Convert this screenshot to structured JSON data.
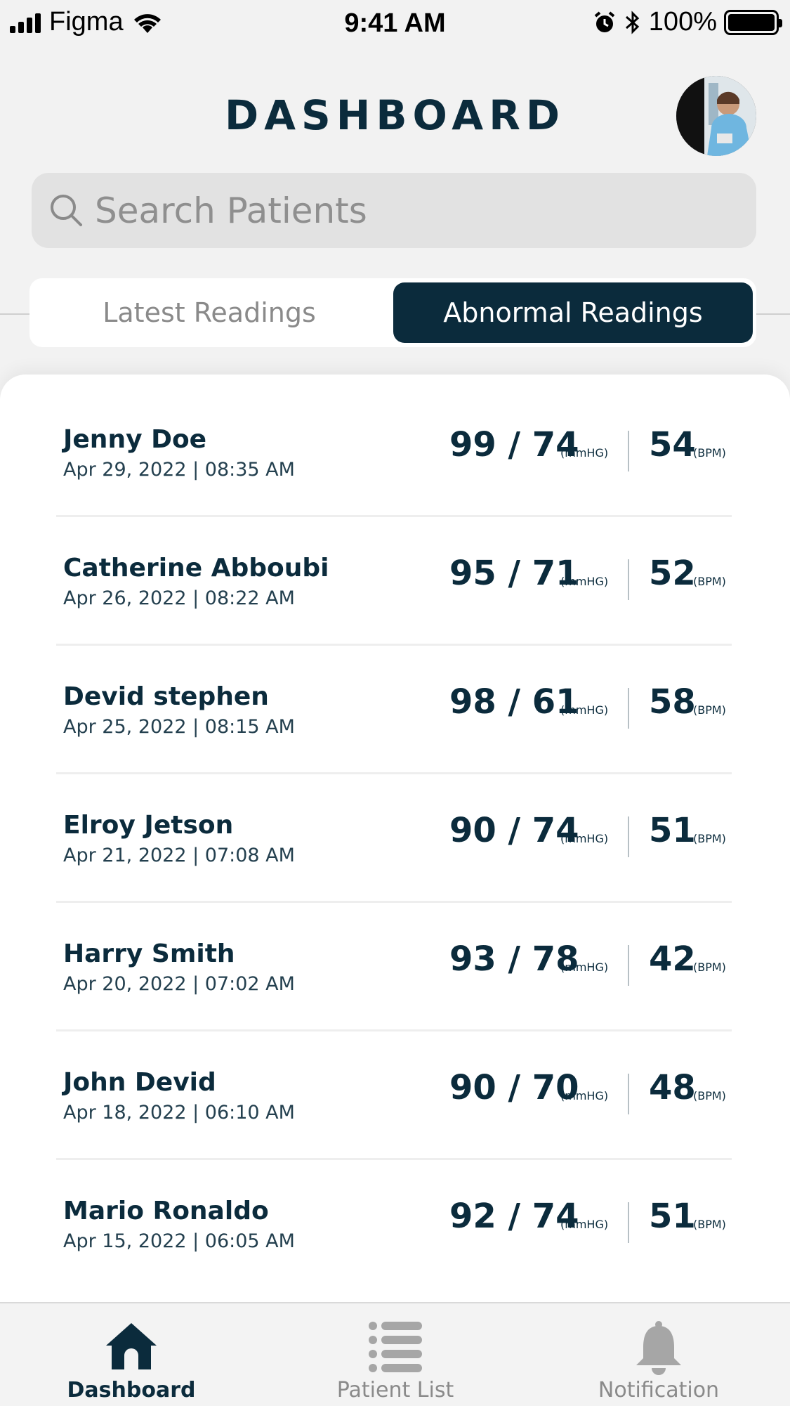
{
  "status_bar": {
    "carrier": "Figma",
    "time": "9:41 AM",
    "battery": "100%"
  },
  "header": {
    "title": "DASHBOARD"
  },
  "search": {
    "placeholder": "Search Patients"
  },
  "tabs": [
    {
      "label": "Latest Readings",
      "active": false
    },
    {
      "label": "Abnormal Readings",
      "active": true
    }
  ],
  "units": {
    "bp": "(mmHG)",
    "hr": "(BPM)"
  },
  "readings": [
    {
      "name": "Jenny Doe",
      "datetime": "Apr 29, 2022 | 08:35 AM",
      "bp": "99 / 74",
      "hr": "54"
    },
    {
      "name": "Catherine Abboubi",
      "datetime": "Apr 26, 2022 | 08:22 AM",
      "bp": "95 / 71",
      "hr": "52"
    },
    {
      "name": "Devid stephen",
      "datetime": "Apr 25, 2022 | 08:15 AM",
      "bp": "98 / 61",
      "hr": "58"
    },
    {
      "name": "Elroy Jetson",
      "datetime": "Apr 21, 2022 | 07:08 AM",
      "bp": "90 / 74",
      "hr": "51"
    },
    {
      "name": "Harry Smith",
      "datetime": "Apr 20, 2022 | 07:02 AM",
      "bp": "93 / 78",
      "hr": "42"
    },
    {
      "name": "John Devid",
      "datetime": "Apr 18, 2022 | 06:10 AM",
      "bp": "90 / 70",
      "hr": "48"
    },
    {
      "name": "Mario Ronaldo",
      "datetime": "Apr 15, 2022 | 06:05 AM",
      "bp": "92 / 74",
      "hr": "51"
    }
  ],
  "bottom_nav": [
    {
      "label": "Dashboard",
      "icon": "home-icon",
      "active": true
    },
    {
      "label": "Patient List",
      "icon": "list-icon",
      "active": false
    },
    {
      "label": "Notification",
      "icon": "bell-icon",
      "active": false
    }
  ],
  "colors": {
    "primary": "#0b2b3c",
    "inactive": "#8a8a8a",
    "background": "#f2f2f2"
  }
}
